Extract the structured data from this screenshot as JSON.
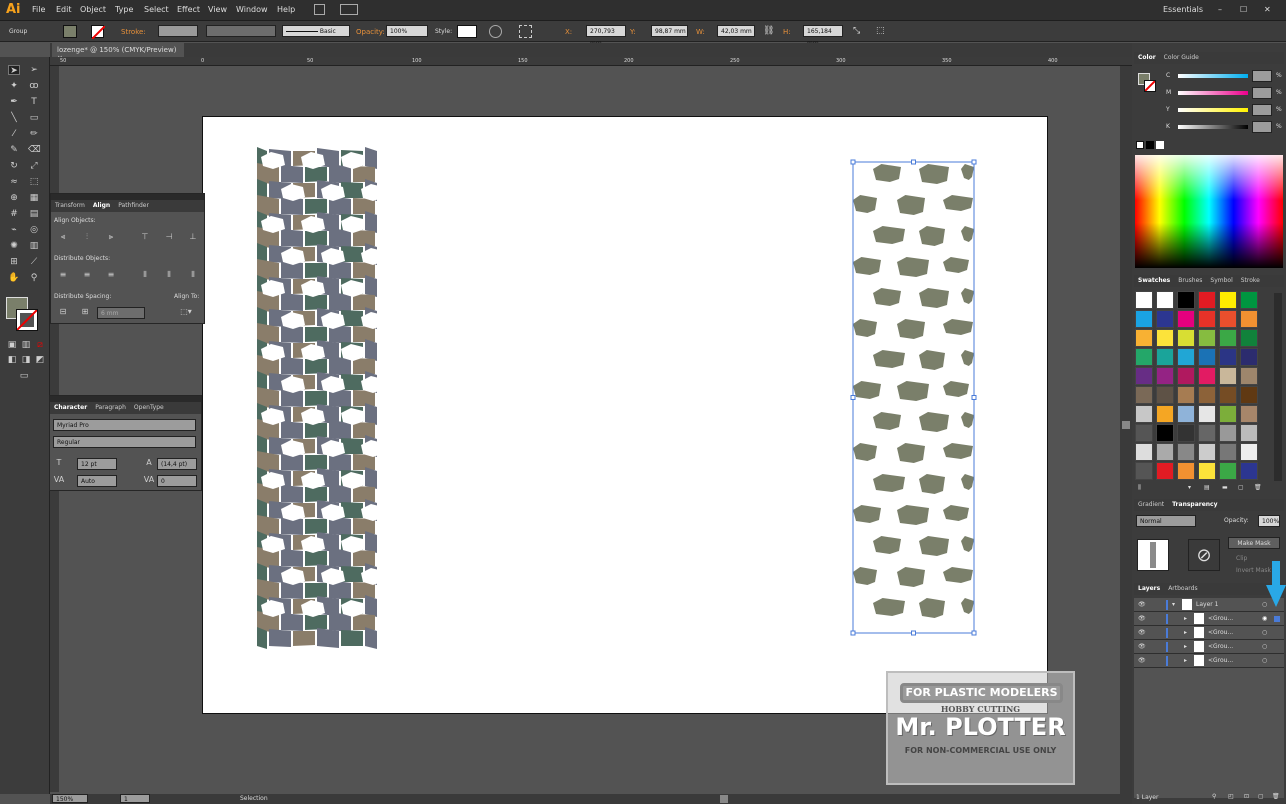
{
  "app": {
    "logo": "Ai"
  },
  "menu": [
    "File",
    "Edit",
    "Object",
    "Type",
    "Select",
    "Effect",
    "View",
    "Window",
    "Help"
  ],
  "workspace": "Essentials",
  "control": {
    "selection_type": "Group",
    "stroke_label": "Stroke:",
    "brush": "Basic",
    "opacity_label": "Opacity:",
    "opacity": "100%",
    "style_label": "Style:",
    "x_label": "X:",
    "x": "270,793 mm",
    "y_label": "Y:",
    "y": "98,87 mm",
    "w_label": "W:",
    "w": "42,03 mm",
    "h_label": "H:",
    "h": "165,184 mm"
  },
  "document": {
    "tab": "lozenge* @ 150% (CMYK/Preview)"
  },
  "ruler": [
    "50",
    "0",
    "50",
    "100",
    "150",
    "200",
    "250",
    "300",
    "350",
    "400"
  ],
  "align_panel": {
    "tabs": [
      "Transform",
      "Align",
      "Pathfinder"
    ],
    "align_objects": "Align Objects:",
    "distribute_objects": "Distribute Objects:",
    "distribute_spacing": "Distribute Spacing:",
    "align_to": "Align To:",
    "spacing_value": "6 mm"
  },
  "character_panel": {
    "tabs": [
      "Character",
      "Paragraph",
      "OpenType"
    ],
    "font": "Myriad Pro",
    "style": "Regular",
    "size": "12 pt",
    "leading": "(14,4 pt)",
    "kerning": "Auto",
    "tracking": "0"
  },
  "color_panel": {
    "tabs": [
      "Color",
      "Color Guide"
    ],
    "channels": [
      "C",
      "M",
      "Y",
      "K"
    ],
    "percent": "%"
  },
  "swatches_panel": {
    "tabs": [
      "Swatches",
      "Brushes",
      "Symbol",
      "Stroke"
    ],
    "rows": [
      [
        "#ffffff",
        "#ffffff",
        "#000000",
        "#e21b23",
        "#ffed00",
        "#009640"
      ],
      [
        "#1aa3e3",
        "#2c3691",
        "#e5007e",
        "#e63228",
        "#e94f2d",
        "#f29131"
      ],
      [
        "#f8b133",
        "#fce33a",
        "#d8de33",
        "#86bc40",
        "#3ba846",
        "#11823b"
      ],
      [
        "#24a769",
        "#1aa49a",
        "#21a6d5",
        "#1b72b5",
        "#2b3585",
        "#2c2c6e"
      ],
      [
        "#672d85",
        "#942384",
        "#b0195f",
        "#e21b63",
        "#c9b79a",
        "#9e866c"
      ],
      [
        "#7a6957",
        "#5e5246",
        "#a67c52",
        "#8c6239",
        "#754c24",
        "#603913"
      ],
      [
        "#c7c7c7",
        "#f5a623",
        "#8fb3d9",
        "#e6e6e6",
        "#7cae3a",
        "#a7866a"
      ],
      [
        "#555555",
        "#000000",
        "#333333",
        "#666666",
        "#999999",
        "#bbbbbb"
      ],
      [
        "#dddddd",
        "#aaaaaa",
        "#888888",
        "#cccccc",
        "#777777",
        "#eeeeee"
      ],
      [
        "#555555",
        "#e21b23",
        "#f29131",
        "#fce33a",
        "#3ba846",
        "#2c3691"
      ]
    ]
  },
  "transparency_panel": {
    "tabs": [
      "Gradient",
      "Transparency"
    ],
    "mode": "Normal",
    "opacity_label": "Opacity:",
    "opacity": "100%",
    "make_mask": "Make Mask",
    "clip": "Clip",
    "invert_mask": "Invert Mask"
  },
  "layers_panel": {
    "tabs": [
      "Layers",
      "Artboards"
    ],
    "layers": [
      {
        "name": "Layer 1",
        "indent": 0
      },
      {
        "name": "<Grou...",
        "indent": 1
      },
      {
        "name": "<Grou...",
        "indent": 1
      },
      {
        "name": "<Grou...",
        "indent": 1
      },
      {
        "name": "<Grou...",
        "indent": 1
      }
    ],
    "footer": "1 Layer"
  },
  "status": {
    "zoom": "150%",
    "page": "1",
    "tool": "Selection"
  },
  "watermark": {
    "line1": "FOR PLASTIC MODELERS",
    "line2": "HOBBY CUTTING",
    "line3": "Mr. PLOTTER",
    "line4": "FOR NON-COMMERCIAL USE ONLY"
  },
  "colors": {
    "pattern_green": "#4e6b60",
    "pattern_blue": "#6b7080",
    "pattern_brown": "#8a7d6a",
    "selected_fill": "#7a7f6a",
    "selection": "#4a7bd8",
    "arrow": "#29a8e6"
  }
}
